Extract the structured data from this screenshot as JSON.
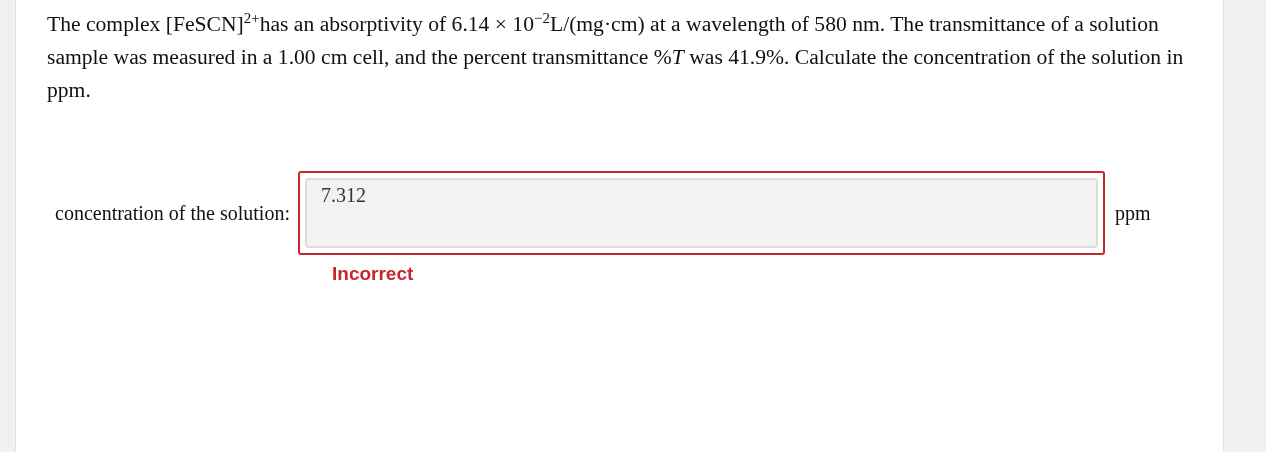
{
  "question": {
    "text": "The complex [FeSCN]$^{2+}$has an absorptivity of 6.14 × 10$^{−2}$L/(mg·cm) at a wavelength of 580 nm. The transmittance of a solution sample was measured in a 1.00 cm cell, and the percent transmittance %*T* was 41.9%. Calculate the concentration of the solution in ppm."
  },
  "answer": {
    "label": "concentration of the solution:",
    "value": "7.312",
    "unit": "ppm",
    "correct": false,
    "feedback": "Incorrect"
  }
}
